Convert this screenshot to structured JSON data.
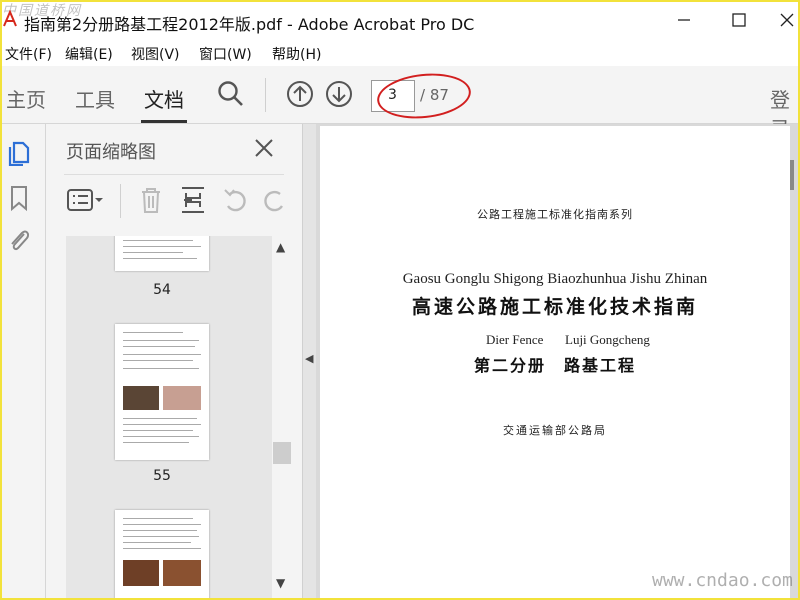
{
  "window": {
    "title": "指南第2分册路基工程2012年版.pdf - Adobe Acrobat Pro DC",
    "watermark_top": "中国道桥网"
  },
  "menu": [
    "文件(F)",
    "编辑(E)",
    "视图(V)",
    "窗口(W)",
    "帮助(H)"
  ],
  "toolbar": {
    "tabs": [
      "主页",
      "工具",
      "文档"
    ],
    "active_tab": "文档",
    "page_current": "3",
    "page_total": "/ 87",
    "login": "登录"
  },
  "panel": {
    "title": "页面缩略图",
    "thumbnails": [
      {
        "label": "54"
      },
      {
        "label": "55"
      },
      {
        "label": ""
      }
    ]
  },
  "document": {
    "series": "公路工程施工标准化指南系列",
    "pinyin_title": "Gaosu Gonglu Shigong Biaozhunhua Jishu Zhinan",
    "title": "高速公路施工标准化技术指南",
    "pinyin_volume": "Dier Fence",
    "pinyin_subject": "Luji Gongcheng",
    "volume": "第二分册　路基工程",
    "publisher": "交通运输部公路局"
  },
  "watermark_bottom": "www.cndao.com",
  "colors": {
    "frame": "#f2e23b",
    "annotation_ellipse": "#d21f1f",
    "app_icon": "#d6281c"
  }
}
